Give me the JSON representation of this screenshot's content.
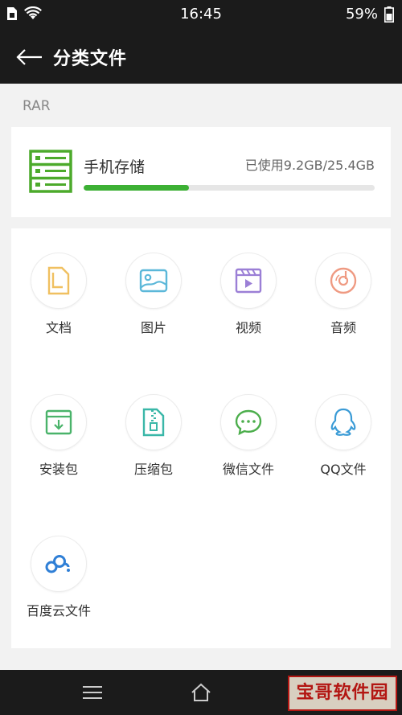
{
  "status_bar": {
    "time": "16:45",
    "battery": "59%"
  },
  "header": {
    "title": "分类文件"
  },
  "section": {
    "label": "RAR"
  },
  "storage": {
    "name": "手机存储",
    "usage": "已使用9.2GB/25.4GB",
    "used_fraction": 0.362
  },
  "categories": [
    {
      "label": "文档",
      "icon": "document-icon"
    },
    {
      "label": "图片",
      "icon": "image-icon"
    },
    {
      "label": "视频",
      "icon": "video-icon"
    },
    {
      "label": "音频",
      "icon": "audio-icon"
    },
    {
      "label": "安装包",
      "icon": "package-icon"
    },
    {
      "label": "压缩包",
      "icon": "archive-icon"
    },
    {
      "label": "微信文件",
      "icon": "wechat-icon"
    },
    {
      "label": "QQ文件",
      "icon": "qq-icon"
    },
    {
      "label": "百度云文件",
      "icon": "baidu-cloud-icon"
    }
  ],
  "watermark": {
    "text": "宝哥软件园"
  },
  "colors": {
    "accent": "#3cb034",
    "dark_bar": "#1b1b1b"
  }
}
